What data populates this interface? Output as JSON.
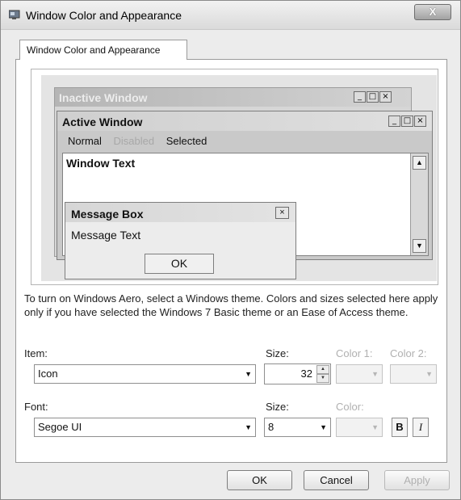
{
  "window": {
    "title": "Window Color and Appearance",
    "close_label": "X"
  },
  "tab": {
    "label": "Window Color and Appearance"
  },
  "preview": {
    "inactive_title": "Inactive Window",
    "active_title": "Active Window",
    "menu_items": [
      {
        "label": "Normal",
        "state": "normal"
      },
      {
        "label": "Disabled",
        "state": "disabled"
      },
      {
        "label": "Selected",
        "state": "selected"
      }
    ],
    "window_text": "Window Text",
    "message_box": {
      "title": "Message Box",
      "text": "Message Text",
      "ok_label": "OK",
      "close_label": "×"
    },
    "caption_buttons": [
      "_",
      "□",
      "×"
    ]
  },
  "description": "To turn on Windows Aero, select a Windows theme.  Colors and sizes selected here apply only if you have selected the Windows 7 Basic theme or an Ease of Access theme.",
  "item": {
    "label": "Item:",
    "value": "Icon",
    "size_label": "Size:",
    "size_value": "32",
    "color1_label": "Color 1:",
    "color2_label": "Color 2:"
  },
  "font": {
    "label": "Font:",
    "value": "Segoe UI",
    "size_label": "Size:",
    "size_value": "8",
    "color_label": "Color:",
    "bold_label": "B",
    "italic_label": "I"
  },
  "buttons": {
    "ok": "OK",
    "cancel": "Cancel",
    "apply": "Apply"
  },
  "colors": {
    "dialog_bg": "#ececec",
    "disabled_text": "#b0b0b0"
  }
}
